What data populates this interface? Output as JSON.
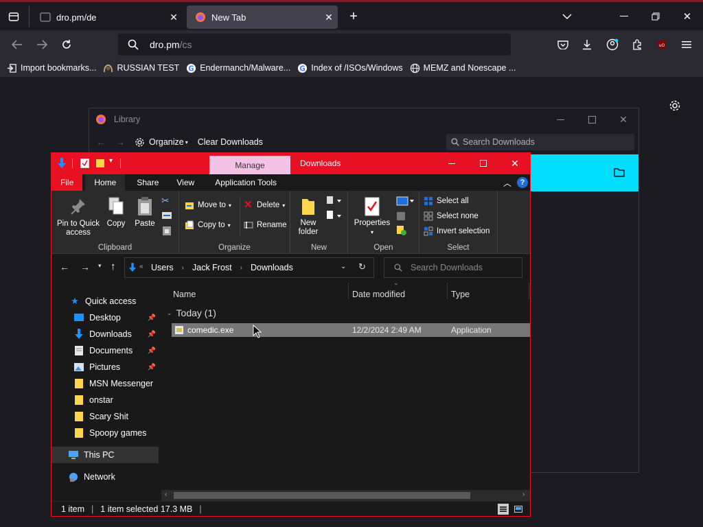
{
  "browser": {
    "tabs": [
      {
        "title": "dro.pm/de"
      },
      {
        "title": "New Tab"
      }
    ],
    "url": {
      "host": "dro.pm",
      "path": "/cs"
    },
    "bookmarks": [
      {
        "label": "Import bookmarks...",
        "icon": "import-icon"
      },
      {
        "label": "RUSSIAN TEST",
        "icon": "cat-icon"
      },
      {
        "label": "Endermanch/Malware...",
        "icon": "google-icon"
      },
      {
        "label": "Index of /ISOs/Windows",
        "icon": "google-icon"
      },
      {
        "label": "MEMZ and Noescape ...",
        "icon": "globe-icon"
      }
    ]
  },
  "library": {
    "title": "Library",
    "organize": "Organize",
    "clear": "Clear Downloads",
    "search_placeholder": "Search Downloads"
  },
  "explorer": {
    "manage_tab": "Manage",
    "title": "Downloads",
    "ribbon_tabs": [
      "File",
      "Home",
      "Share",
      "View",
      "Application Tools"
    ],
    "clipboard": {
      "pin": "Pin to Quick access",
      "copy": "Copy",
      "paste": "Paste",
      "group": "Clipboard"
    },
    "organize": {
      "move": "Move to",
      "copyto": "Copy to",
      "delete": "Delete",
      "rename": "Rename",
      "group": "Organize"
    },
    "new": {
      "folder": "New folder",
      "group": "New"
    },
    "open": {
      "properties": "Properties",
      "group": "Open"
    },
    "select": {
      "all": "Select all",
      "none": "Select none",
      "invert": "Invert selection",
      "group": "Select"
    },
    "path": [
      "Users",
      "Jack Frost",
      "Downloads"
    ],
    "search_placeholder": "Search Downloads",
    "nav": {
      "quick_access": "Quick access",
      "items": [
        "Desktop",
        "Downloads",
        "Documents",
        "Pictures",
        "MSN Messenger",
        "onstar",
        "Scary Shit",
        "Spoopy games"
      ],
      "this_pc": "This PC",
      "network": "Network"
    },
    "columns": {
      "name": "Name",
      "date": "Date modified",
      "type": "Type"
    },
    "group_header": "Today (1)",
    "files": [
      {
        "name": "comedic.exe",
        "date": "12/2/2024 2:49 AM",
        "type": "Application"
      }
    ],
    "status": {
      "count": "1 item",
      "selected": "1 item selected  17.3 MB"
    }
  }
}
